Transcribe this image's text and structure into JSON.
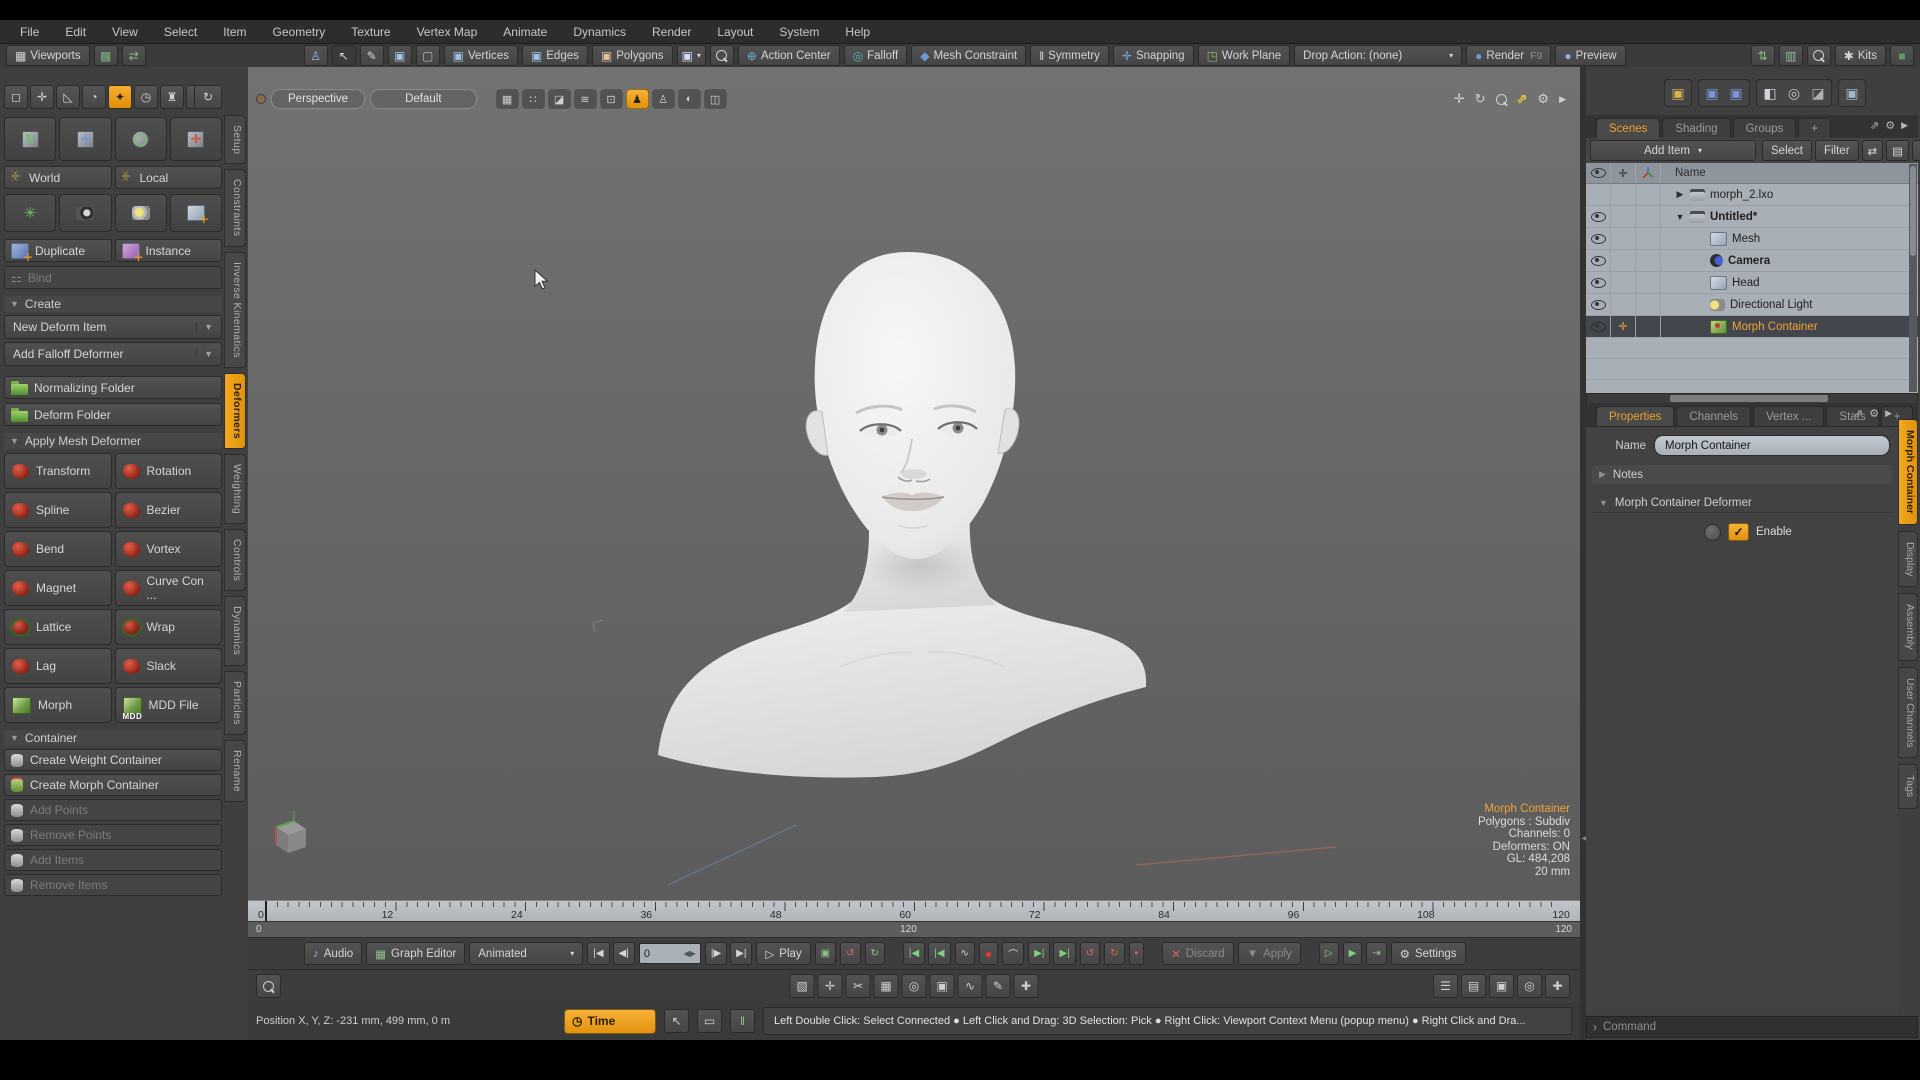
{
  "accent": "#ec9c1e",
  "menu": {
    "items": [
      "File",
      "Edit",
      "View",
      "Select",
      "Item",
      "Geometry",
      "Texture",
      "Vertex Map",
      "Animate",
      "Dynamics",
      "Render",
      "Layout",
      "System",
      "Help"
    ]
  },
  "icons": {
    "grid": "▦",
    "layout": "▩",
    "swap": "⇄",
    "ghost": "♙",
    "cursor": "↖",
    "pencil": "✎",
    "cube": "▣",
    "cube2": "▢",
    "caret": "▾",
    "action_center": "⊕",
    "falloff": "◎",
    "mesh_constraint": "◆",
    "symmetry": "‖",
    "snapping": "✛",
    "work_plane": "◳",
    "ball": "●",
    "updown": "⇅",
    "cols": "▥",
    "star": "✱",
    "square": "■",
    "pan": "✛",
    "orbit": "↻",
    "expand": "⇗",
    "gear": "⚙",
    "more": "▶",
    "note": "♪",
    "graph": "▦",
    "tri": "▶",
    "tri_o": "▷",
    "rec": "●",
    "wave": "∿",
    "undo": "↺",
    "redo": "↻",
    "dot": "▪",
    "x": "✕",
    "down": "▼",
    "into": "⇥",
    "clock": "◷",
    "monitor": "▭",
    "bars": "‖",
    "menu_lines": "☰",
    "rows": "▤",
    "funnel": "▼",
    "plus": "✚",
    "chev": "›",
    "axisstar": "✳",
    "scissors": "✂",
    "circle": "◎",
    "spline": "∿",
    "gsq": "◪"
  },
  "toolbar": {
    "viewports": "Viewports",
    "vertices": "Vertices",
    "edges": "Edges",
    "polygons": "Polygons",
    "action_center": "Action Center",
    "falloff": "Falloff",
    "mesh_constraint": "Mesh Constraint",
    "symmetry": "Symmetry",
    "snapping": "Snapping",
    "work_plane": "Work Plane",
    "drop_action": "Drop Action: (none)",
    "render": "Render",
    "render_key": "F9",
    "preview": "Preview",
    "kits": "Kits"
  },
  "left_tabs": [
    {
      "label": "Setup"
    },
    {
      "label": "Constraints"
    },
    {
      "label": "Inverse Kinematics"
    },
    {
      "label": "Deformers",
      "active": true
    },
    {
      "label": "Weighting"
    },
    {
      "label": "Controls"
    },
    {
      "label": "Dynamics"
    },
    {
      "label": "Particles"
    },
    {
      "label": "Rename"
    }
  ],
  "sidebar": {
    "tools": [
      {
        "g": "◻"
      },
      {
        "g": "✛"
      },
      {
        "g": "◺"
      },
      {
        "g": "◔"
      },
      {
        "g": "✦",
        "active": true
      },
      {
        "g": "◷"
      },
      {
        "g": "♜"
      },
      {
        "g": "⊙"
      }
    ],
    "refresh": "↻",
    "world": "World",
    "local": "Local",
    "duplicate": "Duplicate",
    "instance": "Instance",
    "bind": "Bind",
    "create": "Create",
    "new_deform_item": "New Deform Item",
    "add_falloff_deformer": "Add Falloff Deformer",
    "normalizing_folder": "Normalizing Folder",
    "deform_folder": "Deform Folder",
    "apply_mesh_deformer": "Apply Mesh Deformer",
    "deformers": [
      {
        "label": "Transform",
        "icon": "blob"
      },
      {
        "label": "Rotation",
        "icon": "blob"
      },
      {
        "label": "Spline",
        "icon": "blob"
      },
      {
        "label": "Bezier",
        "icon": "blob"
      },
      {
        "label": "Bend",
        "icon": "blob"
      },
      {
        "label": "Vortex",
        "icon": "blob"
      },
      {
        "label": "Magnet",
        "icon": "blob"
      },
      {
        "label": "Curve Con ...",
        "icon": "blob"
      },
      {
        "label": "Lattice",
        "icon": "blobdots"
      },
      {
        "label": "Wrap",
        "icon": "blobdots"
      },
      {
        "label": "Lag",
        "icon": "blob"
      },
      {
        "label": "Slack",
        "icon": "blob"
      },
      {
        "label": "Morph",
        "icon": "gcube"
      },
      {
        "label": "MDD File",
        "icon": "gcube",
        "sub": "MDD"
      }
    ],
    "container": "Container",
    "container_items": [
      {
        "label": "Create Weight Container"
      },
      {
        "label": "Create Morph Container",
        "morph": true
      },
      {
        "label": "Add Points",
        "disabled": true
      },
      {
        "label": "Remove Points",
        "disabled": true
      },
      {
        "label": "Add Items",
        "disabled": true
      },
      {
        "label": "Remove Items",
        "disabled": true
      }
    ]
  },
  "viewport": {
    "mode": "Perspective",
    "preset": "Default",
    "header_icons": [
      {
        "g": "▦"
      },
      {
        "g": "∷"
      },
      {
        "g": "◪"
      },
      {
        "g": "≋"
      },
      {
        "g": "⊡"
      },
      {
        "g": "♟",
        "active": true
      },
      {
        "g": "♙"
      },
      {
        "g": "◐"
      },
      {
        "g": "◫"
      }
    ],
    "info": {
      "title": "Morph Container",
      "lines": [
        "Polygons : Subdiv",
        "Channels: 0",
        "Deformers: ON",
        "GL: 484,208",
        "20 mm"
      ]
    }
  },
  "timeline": {
    "labels": [
      "0",
      "12",
      "24",
      "36",
      "48",
      "60",
      "72",
      "84",
      "96",
      "108",
      "120"
    ],
    "range_start": "0",
    "range_mid": "120",
    "range_end": "120"
  },
  "transport": {
    "audio": "Audio",
    "graph_editor": "Graph Editor",
    "mode": "Animated",
    "frame": "0",
    "play": "Play",
    "nav": [
      {
        "g": "|◀"
      },
      {
        "g": "◀|"
      }
    ],
    "nav2": [
      {
        "g": "|▶"
      },
      {
        "g": "▶|"
      }
    ],
    "knav": [
      {
        "g": "|◀"
      },
      {
        "g": "|◀"
      }
    ],
    "knav2": [
      {
        "g": "▶|"
      },
      {
        "g": "▶|"
      }
    ],
    "discard": "Discard",
    "apply": "Apply",
    "settings": "Settings"
  },
  "toolrow2": {
    "center_icons": [
      {
        "g": "▧"
      },
      {
        "g": "✛"
      },
      {
        "g": "✂"
      },
      {
        "g": "▦"
      },
      {
        "g": "◎"
      },
      {
        "g": "▣"
      },
      {
        "g": "∿"
      },
      {
        "g": "✎"
      },
      {
        "g": "✚"
      }
    ],
    "right_icons": [
      {
        "g": "☰"
      },
      {
        "g": "▤"
      },
      {
        "g": "▣"
      },
      {
        "g": "◎"
      },
      {
        "g": "✚"
      }
    ]
  },
  "status": {
    "position": "Position X, Y, Z:   -231 mm, 499 mm, 0 m",
    "time": "Time",
    "help": "Left Double Click: Select Connected ● Left Click and Drag: 3D Selection: Pick ● Right Click: Viewport Context Menu (popup menu) ● Right Click and Dra..."
  },
  "scenes": {
    "tabs": [
      {
        "label": "Scenes",
        "active": true
      },
      {
        "label": "Shading"
      },
      {
        "label": "Groups"
      },
      {
        "label": "+",
        "small": true
      }
    ],
    "add_item": "Add Item",
    "select": "Select",
    "filter": "Filter",
    "name_col": "Name",
    "tree": [
      {
        "label": "morph_2.lxo",
        "expander": "▶",
        "icon": "ic-scene"
      },
      {
        "label": "Untitled*",
        "expander": "▼",
        "icon": "ic-scene",
        "eye": true,
        "bold": true
      },
      {
        "label": "Mesh",
        "icon": "ic-mesh",
        "eye": true,
        "dim": true,
        "child": true
      },
      {
        "label": "Camera",
        "icon": "ic-camera",
        "eye": true,
        "bold": true,
        "child": true
      },
      {
        "label": "Head",
        "icon": "ic-mesh",
        "eye": true,
        "child": true
      },
      {
        "label": "Directional Light",
        "icon": "ic-light",
        "eye": true,
        "child": true
      },
      {
        "label": "Morph Container",
        "icon": "ic-morph",
        "eye": true,
        "pin": true,
        "selected": true,
        "child": true
      }
    ]
  },
  "properties": {
    "tabs": [
      {
        "label": "Properties",
        "active": true
      },
      {
        "label": "Channels"
      },
      {
        "label": "Vertex ..."
      },
      {
        "label": "Stats"
      },
      {
        "label": "+",
        "small": true
      }
    ],
    "name_label": "Name",
    "name_value": "Morph Container",
    "notes": "Notes",
    "section": "Morph Container Deformer",
    "enable": "Enable",
    "check": "✓"
  },
  "right_tabs": [
    {
      "label": "Morph Container",
      "active": true
    },
    {
      "label": "Display"
    },
    {
      "label": "Assembly"
    },
    {
      "label": "User Channels"
    },
    {
      "label": "Tags"
    }
  ],
  "command": {
    "placeholder": "Command"
  }
}
